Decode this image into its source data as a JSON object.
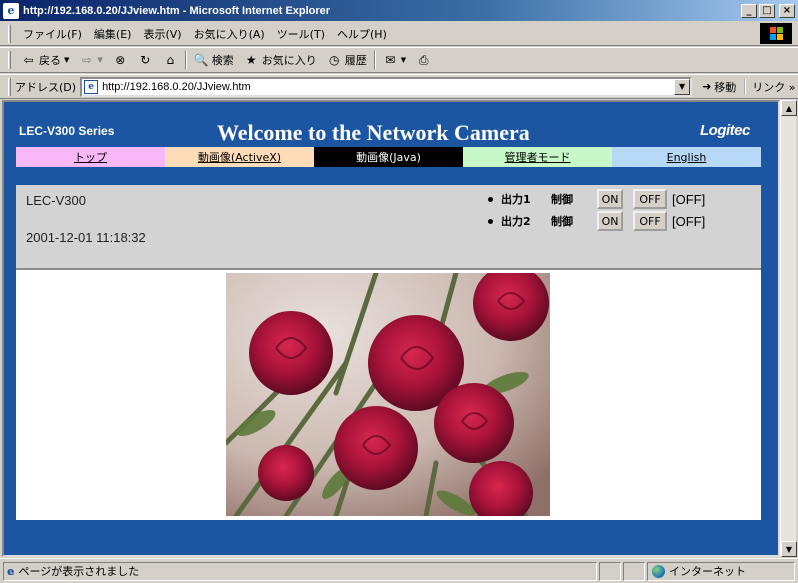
{
  "window": {
    "title": "http://192.168.0.20/JJview.htm - Microsoft Internet Explorer",
    "minimize": "_",
    "maximize": "□",
    "close": "×"
  },
  "menu": [
    "ファイル(F)",
    "編集(E)",
    "表示(V)",
    "お気に入り(A)",
    "ツール(T)",
    "ヘルプ(H)"
  ],
  "toolbar": {
    "back": "戻る",
    "search": "検索",
    "favorites": "お気に入り",
    "history": "履歴"
  },
  "address": {
    "label": "アドレス(D)",
    "url": "http://192.168.0.20/JJview.htm",
    "go": "移動",
    "links": "リンク »"
  },
  "page": {
    "series": "LEC-V300 Series",
    "headline": "Welcome to the Network Camera",
    "logo": "Logitec",
    "nav": [
      {
        "label": "トップ",
        "bg": "#f8b8f8",
        "color": "#000"
      },
      {
        "label": "動画像(ActiveX)",
        "bg": "#ffdcb8",
        "color": "#000"
      },
      {
        "label": "動画像(Java)",
        "bg": "#000000",
        "color": "#fff"
      },
      {
        "label": "管理者モード",
        "bg": "#c8f8c8",
        "color": "#000"
      },
      {
        "label": "English",
        "bg": "#b8d8f8",
        "color": "#000"
      }
    ],
    "device_name": "LEC-V300",
    "timestamp": "2001-12-01 11:18:32",
    "outputs": [
      {
        "name": "出力1",
        "control": "制御",
        "on": "ON",
        "off": "OFF",
        "state": "[OFF]"
      },
      {
        "name": "出力2",
        "control": "制御",
        "on": "ON",
        "off": "OFF",
        "state": "[OFF]"
      }
    ],
    "camera_image": "rose-bouquet-photo"
  },
  "status": {
    "text": "ページが表示されました",
    "zone": "インターネット"
  },
  "colors": {
    "page_bg": "#1c56a3",
    "status_panel": "#d3d3d3"
  }
}
